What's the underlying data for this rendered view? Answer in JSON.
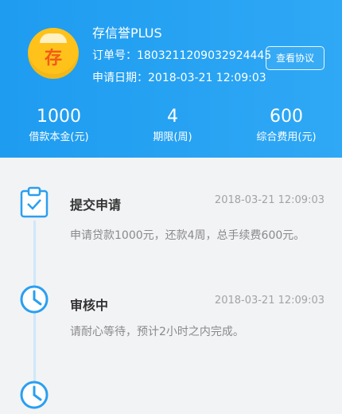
{
  "header": {
    "product_name": "存信誉PLUS",
    "logo_char": "存",
    "order_no": "订单号：1803211209032924445",
    "apply_date": "申请日期：2018-03-21 12:09:03",
    "agreement_button": "查看协议"
  },
  "stats": [
    {
      "value": "1000",
      "label": "借款本金(元)"
    },
    {
      "value": "4",
      "label": "期限(周)"
    },
    {
      "value": "600",
      "label": "综合费用(元)"
    }
  ],
  "timeline": [
    {
      "title": "提交申请",
      "time": "2018-03-21 12:09:03",
      "desc": "申请贷款1000元，还款4周，总手续费600元。",
      "icon": "clipboard-check-icon"
    },
    {
      "title": "审核中",
      "time": "2018-03-21 12:09:03",
      "desc": "请耐心等待，预计2小时之内完成。",
      "icon": "clock-icon"
    },
    {
      "icon": "clock-icon"
    }
  ],
  "colors": {
    "header_blue": "#1e9cf0",
    "icon_blue": "#2a9ff0",
    "logo_yellow": "#ffc21a"
  }
}
